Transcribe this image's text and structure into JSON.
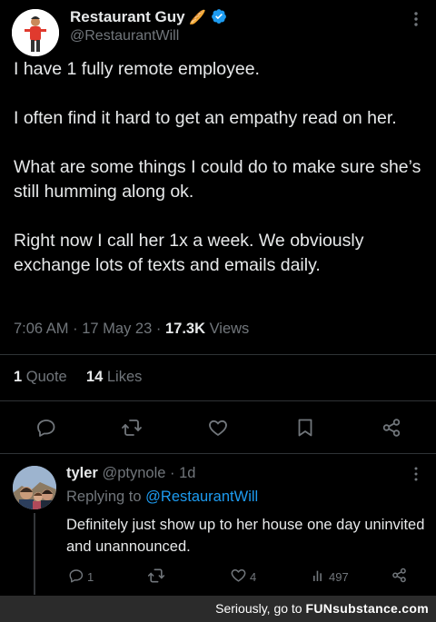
{
  "tweet": {
    "display_name": "Restaurant Guy",
    "emoji": "🥖",
    "handle": "@RestaurantWill",
    "paragraphs": [
      "I have 1 fully remote employee.",
      "I often find it hard to get an empathy read on her.",
      "What are some things I could do to make sure she’s still humming along ok.",
      "Right now I call her 1x a week.  We obviously exchange lots of texts and emails daily."
    ],
    "time": "7:06 AM",
    "sep": "·",
    "date": "17 May 23",
    "views_count": "17.3K",
    "views_label": "Views",
    "quote_count": "1",
    "quote_label": "Quote",
    "likes_count": "14",
    "likes_label": "Likes"
  },
  "reply": {
    "display_name": "tyler",
    "handle": "@ptynole",
    "age": "· 1d",
    "replying_prefix": "Replying to",
    "replying_to": "@RestaurantWill",
    "text": "Definitely just show up to her house one day uninvited and unannounced.",
    "reply_count": "1",
    "like_count": "4",
    "view_count": "497"
  },
  "footer": {
    "prefix": "Seriously, go to",
    "brand": "FUNsubstance.com"
  },
  "colors": {
    "background": "#000000",
    "text": "#e7e9ea",
    "muted": "#71767b",
    "link": "#1d9bf0",
    "verified": "#1d9bf0"
  },
  "icons": [
    "verified-badge-icon",
    "more-icon",
    "reply-icon",
    "retweet-icon",
    "like-icon",
    "bookmark-icon",
    "share-icon",
    "views-icon"
  ]
}
